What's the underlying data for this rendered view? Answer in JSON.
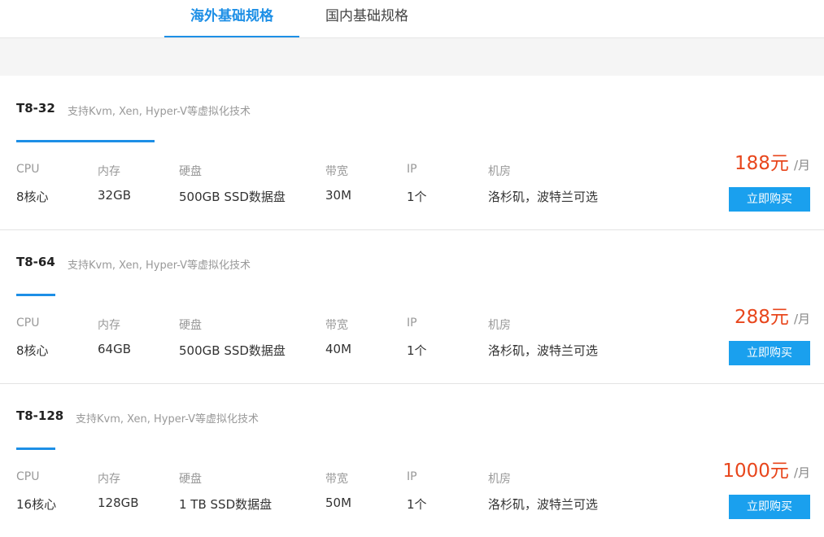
{
  "tabs": [
    {
      "label": "海外基础规格",
      "active": true
    },
    {
      "label": "国内基础规格",
      "active": false
    }
  ],
  "columns": {
    "cpu": "CPU",
    "memory": "内存",
    "disk": "硬盘",
    "bandwidth": "带宽",
    "ip": "IP",
    "datacenter": "机房"
  },
  "plans": [
    {
      "name": "T8-32",
      "description": "支持Kvm, Xen, Hyper-V等虚拟化技术",
      "cpu": "8核心",
      "memory": "32GB",
      "disk": "500GB SSD数据盘",
      "bandwidth": "30M",
      "ip": "1个",
      "datacenter": "洛杉矶，波特兰可选",
      "price": "188元",
      "unit": "/月",
      "buy_label": "立即购买"
    },
    {
      "name": "T8-64",
      "description": "支持Kvm, Xen, Hyper-V等虚拟化技术",
      "cpu": "8核心",
      "memory": "64GB",
      "disk": "500GB SSD数据盘",
      "bandwidth": "40M",
      "ip": "1个",
      "datacenter": "洛杉矶，波特兰可选",
      "price": "288元",
      "unit": "/月",
      "buy_label": "立即购买"
    },
    {
      "name": "T8-128",
      "description": "支持Kvm, Xen, Hyper-V等虚拟化技术",
      "cpu": "16核心",
      "memory": "128GB",
      "disk": "1 TB SSD数据盘",
      "bandwidth": "50M",
      "ip": "1个",
      "datacenter": "洛杉矶，波特兰可选",
      "price": "1000元",
      "unit": "/月",
      "buy_label": "立即购买"
    }
  ],
  "colors": {
    "accent": "#1d8fe6",
    "price": "#e8461c",
    "button": "#1aa0ee"
  }
}
